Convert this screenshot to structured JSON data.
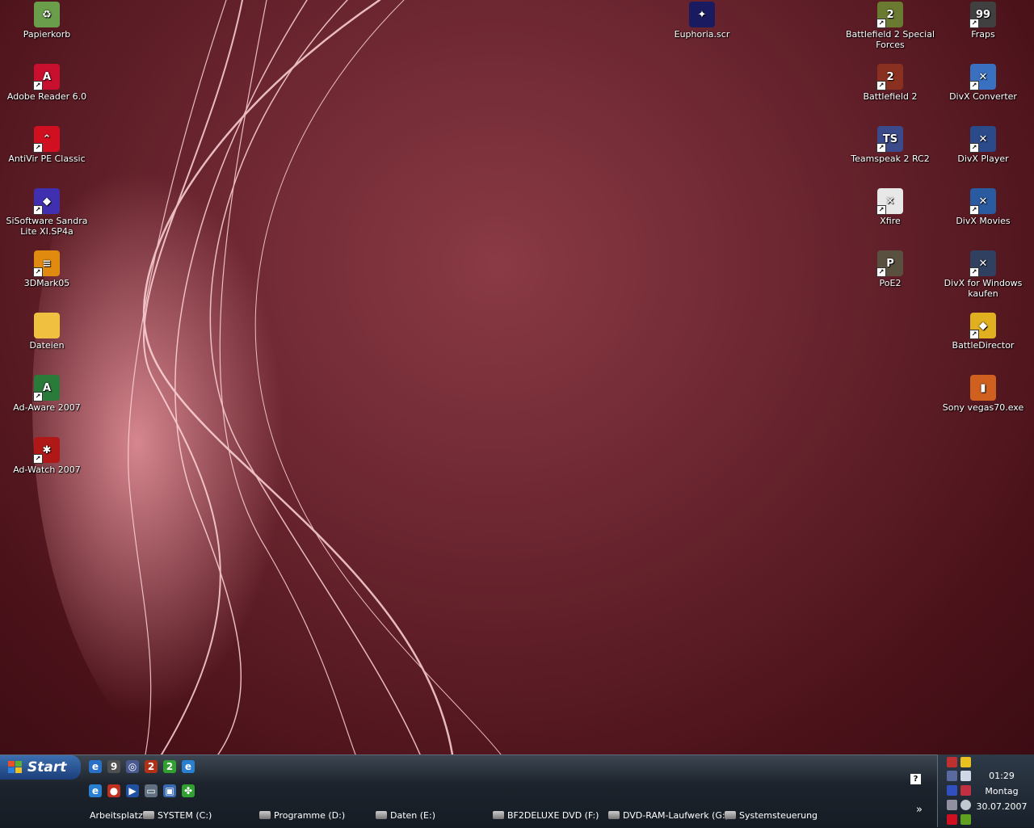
{
  "desktop_icons_left": [
    {
      "label": "Papierkorb",
      "icon": "recycle-bin-icon",
      "color": "#6a9e4a",
      "glyph": "♻",
      "shortcut": false
    },
    {
      "label": "Adobe Reader 6.0",
      "icon": "adobe-reader-icon",
      "color": "#c8102e",
      "glyph": "A",
      "shortcut": true
    },
    {
      "label": "AntiVir PE Classic",
      "icon": "antivir-icon",
      "color": "#d01020",
      "glyph": "⌃",
      "shortcut": true
    },
    {
      "label": "SiSoftware Sandra Lite XI.SP4a",
      "icon": "sandra-icon",
      "color": "#4030b0",
      "glyph": "◆",
      "shortcut": true
    },
    {
      "label": "3DMark05",
      "icon": "3dmark-icon",
      "color": "#e08a10",
      "glyph": "≡",
      "shortcut": true
    },
    {
      "label": "Dateien",
      "icon": "folder-icon",
      "color": "#f0c040",
      "glyph": "",
      "shortcut": false
    },
    {
      "label": "Ad-Aware 2007",
      "icon": "ad-aware-icon",
      "color": "#2a7a3a",
      "glyph": "A",
      "shortcut": true
    },
    {
      "label": "Ad-Watch 2007",
      "icon": "ad-watch-icon",
      "color": "#b01818",
      "glyph": "✱",
      "shortcut": true
    }
  ],
  "desktop_icons_mid": [
    {
      "label": "Euphoria.scr",
      "icon": "euphoria-icon",
      "color": "#1a1a60",
      "glyph": "✦",
      "shortcut": false
    }
  ],
  "desktop_icons_col2": [
    {
      "label": "Battlefield 2 Special Forces",
      "icon": "bf2-special-forces-icon",
      "color": "#6a7a30",
      "glyph": "2",
      "shortcut": true
    },
    {
      "label": "Battlefield 2",
      "icon": "bf2-icon",
      "color": "#8a3020",
      "glyph": "2",
      "shortcut": true
    },
    {
      "label": "Teamspeak 2 RC2",
      "icon": "teamspeak-icon",
      "color": "#3a4a8a",
      "glyph": "TS",
      "shortcut": true
    },
    {
      "label": "Xfire",
      "icon": "xfire-icon",
      "color": "#e8e8e8",
      "glyph": "✕",
      "shortcut": true
    },
    {
      "label": "PoE2",
      "icon": "poe2-icon",
      "color": "#5a5040",
      "glyph": "P",
      "shortcut": true
    }
  ],
  "desktop_icons_col3": [
    {
      "label": "Fraps",
      "icon": "fraps-icon",
      "color": "#404040",
      "glyph": "99",
      "shortcut": true
    },
    {
      "label": "DivX Converter",
      "icon": "divx-converter-icon",
      "color": "#3a70c0",
      "glyph": "✕",
      "shortcut": true
    },
    {
      "label": "DivX Player",
      "icon": "divx-player-icon",
      "color": "#2a4a8a",
      "glyph": "✕",
      "shortcut": true
    },
    {
      "label": "DivX Movies",
      "icon": "divx-movies-icon",
      "color": "#2a5aa0",
      "glyph": "✕",
      "shortcut": true
    },
    {
      "label": "DivX for Windows kaufen",
      "icon": "divx-buy-icon",
      "color": "#304060",
      "glyph": "✕",
      "shortcut": true
    },
    {
      "label": "BattleDirector",
      "icon": "battledirector-icon",
      "color": "#e0b020",
      "glyph": "◆",
      "shortcut": true
    },
    {
      "label": "Sony vegas70.exe",
      "icon": "sony-vegas-icon",
      "color": "#d06020",
      "glyph": "▮",
      "shortcut": false
    }
  ],
  "taskbar": {
    "start_label": "Start",
    "quicklaunch_row1": [
      {
        "icon": "outlook-icon",
        "color": "#2a70c8",
        "glyph": "e"
      },
      {
        "icon": "fraps-quick-icon",
        "color": "#505050",
        "glyph": "9"
      },
      {
        "icon": "teamspeak-quick-icon",
        "color": "#4a5a90",
        "glyph": "◎"
      },
      {
        "icon": "bf2-quick-icon",
        "color": "#b03018",
        "glyph": "2"
      },
      {
        "icon": "bf2sf-quick-icon",
        "color": "#30a030",
        "glyph": "2"
      },
      {
        "icon": "ie-quick-icon",
        "color": "#2a80d0",
        "glyph": "e"
      }
    ],
    "quicklaunch_row2": [
      {
        "icon": "internet-explorer-icon",
        "color": "#2a80d0",
        "glyph": "e"
      },
      {
        "icon": "media-icon",
        "color": "#c03020",
        "glyph": "●"
      },
      {
        "icon": "player-icon",
        "color": "#2050a0",
        "glyph": "▶"
      },
      {
        "icon": "show-desktop-icon",
        "color": "#607080",
        "glyph": "▭"
      },
      {
        "icon": "network-icon",
        "color": "#3a6ab0",
        "glyph": "▣"
      },
      {
        "icon": "clover-icon",
        "color": "#30a030",
        "glyph": "✤"
      }
    ],
    "toolbar_title": "Arbeitsplatz",
    "drives": [
      {
        "label": "SYSTEM (C:)",
        "icon": "drive-c-icon"
      },
      {
        "label": "Programme (D:)",
        "icon": "drive-d-icon"
      },
      {
        "label": "Daten (E:)",
        "icon": "drive-e-icon"
      },
      {
        "label": "BF2DELUXE DVD (F:)",
        "icon": "dvd-f-icon"
      },
      {
        "label": "DVD-RAM-Laufwerk (G:)",
        "icon": "dvd-ram-g-icon"
      },
      {
        "label": "Systemsteuerung",
        "icon": "control-panel-icon"
      }
    ],
    "help_label": "?",
    "chevron": "»"
  },
  "tray": {
    "time": "01:29",
    "day": "Montag",
    "date": "30.07.2007"
  }
}
